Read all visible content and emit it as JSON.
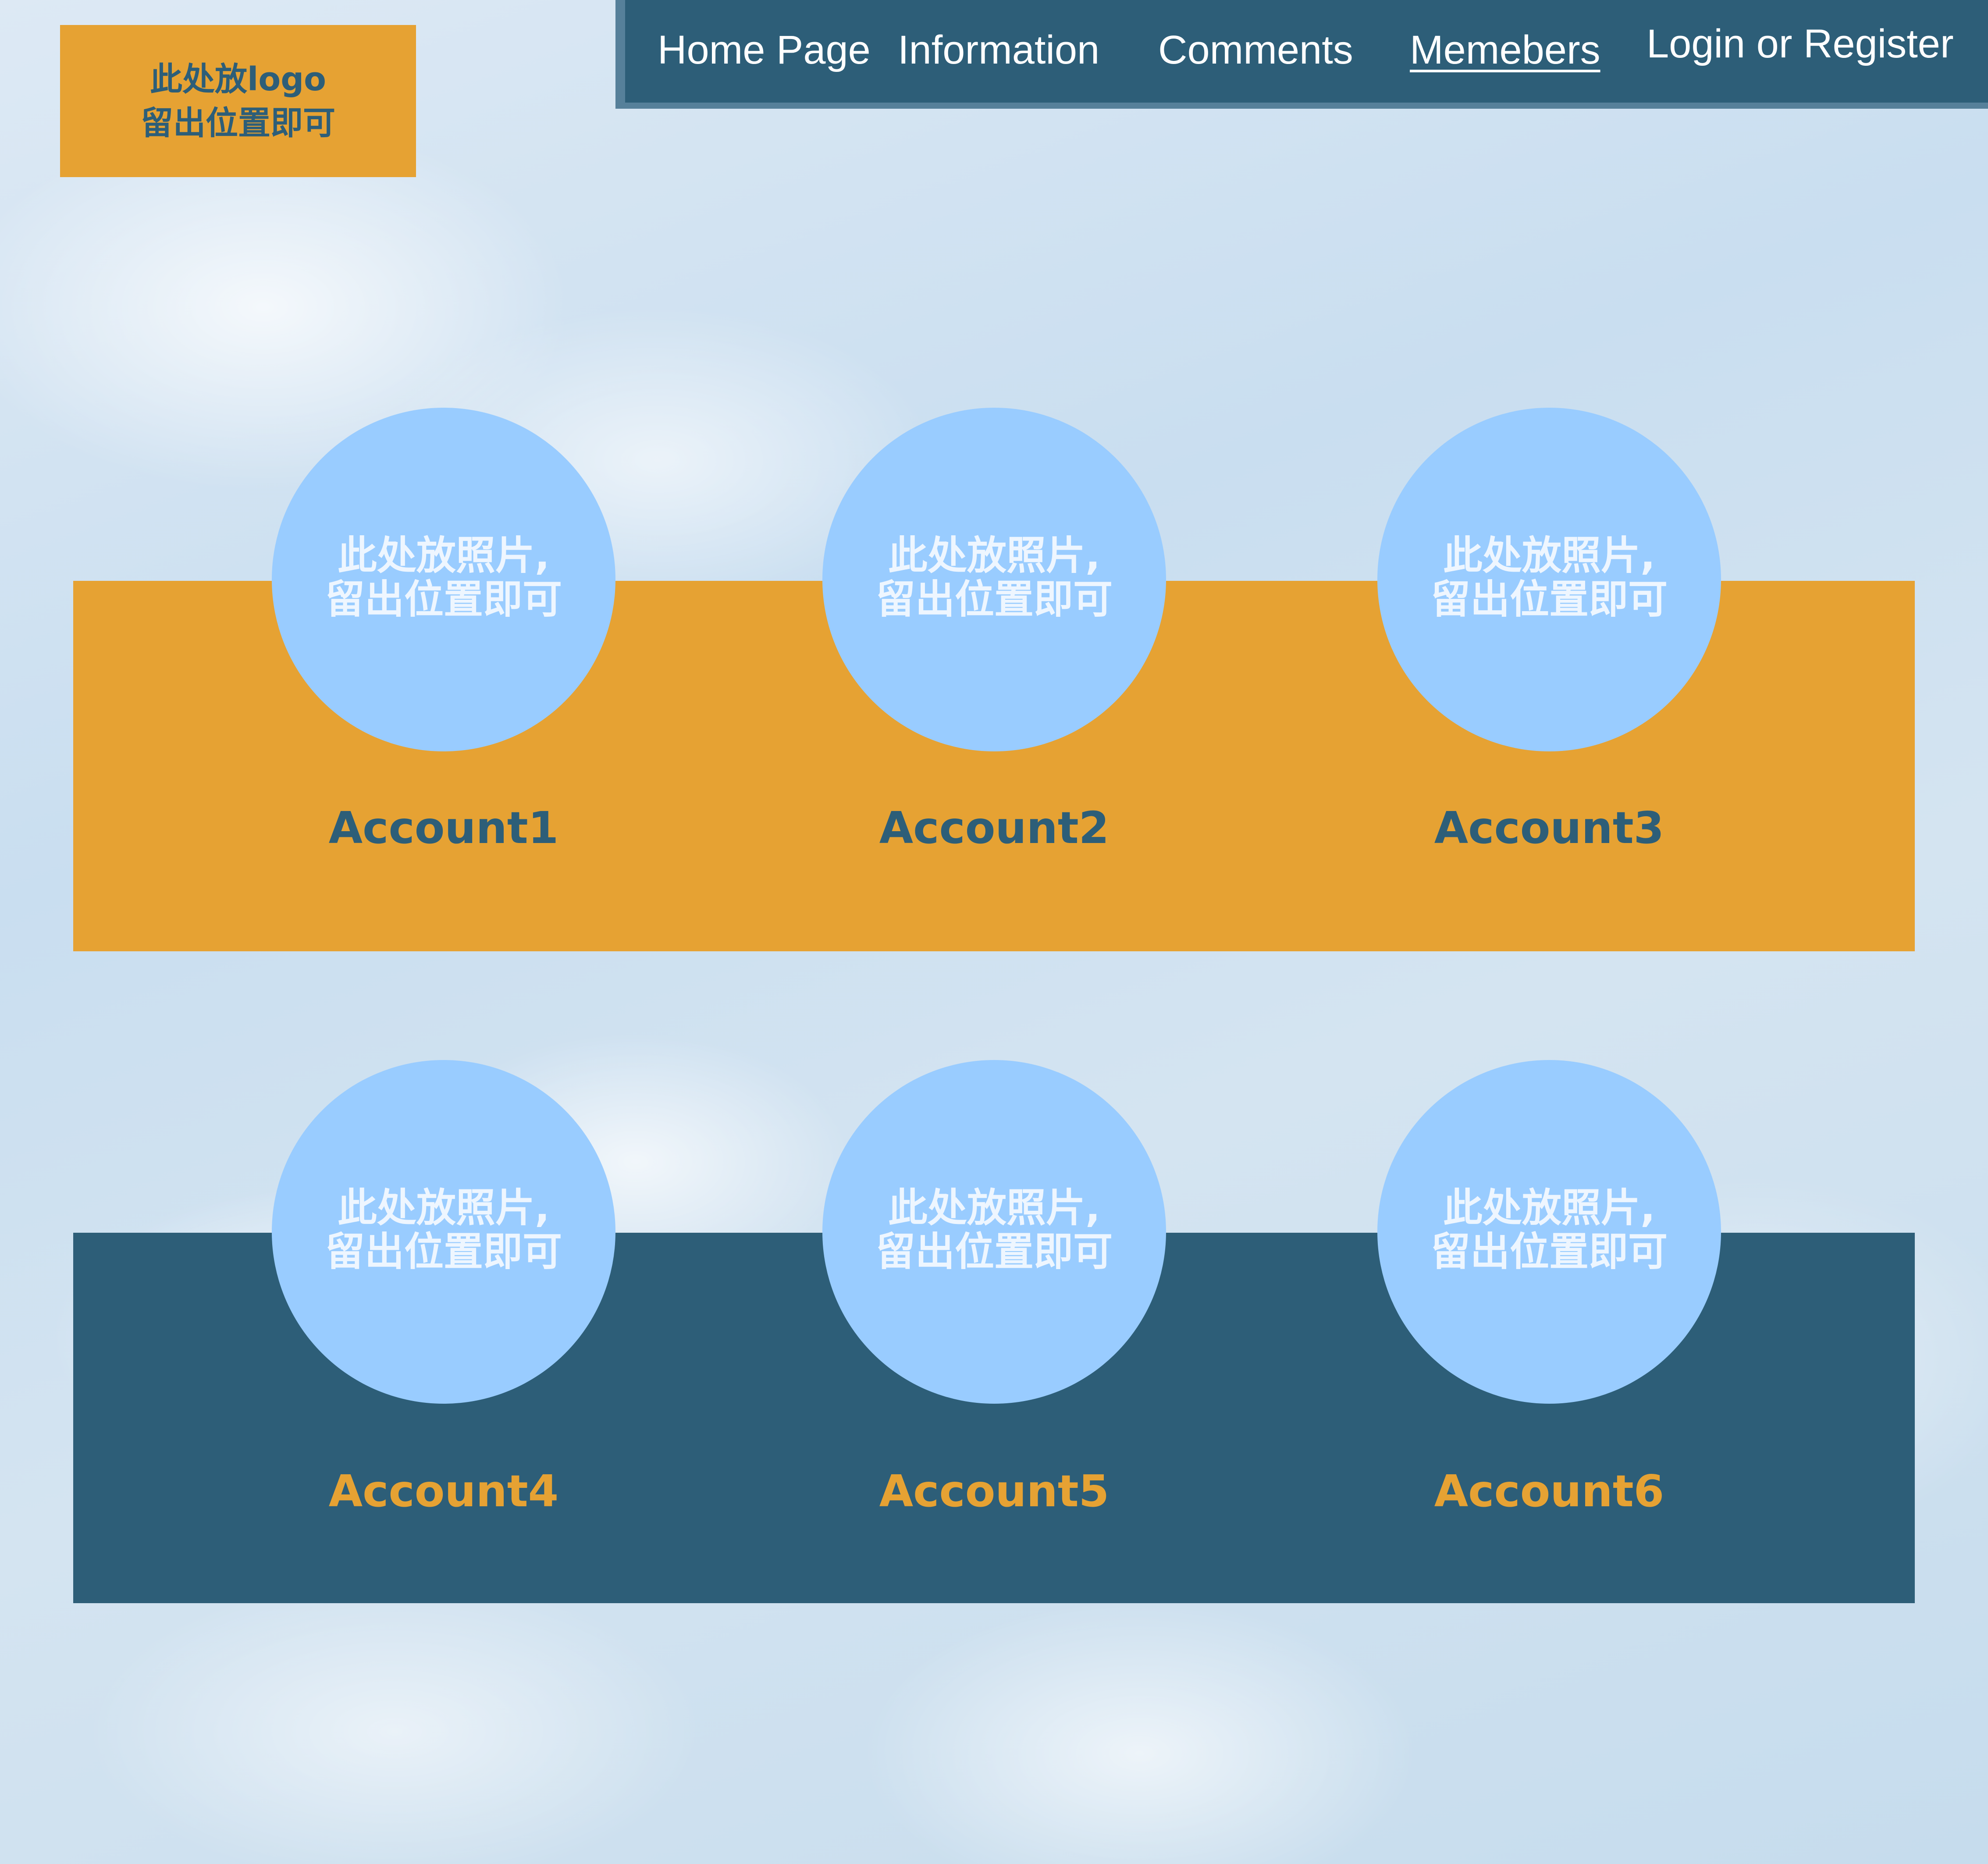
{
  "logo": {
    "line1": "此处放logo",
    "line2": "留出位置即可"
  },
  "nav": {
    "items": [
      {
        "label": "Home Page"
      },
      {
        "label": "Information"
      },
      {
        "label": "Comments"
      },
      {
        "label": "Memebers",
        "active": true
      },
      {
        "label": "Login or Register"
      }
    ]
  },
  "members": {
    "photo_line1": "此处放照片,",
    "photo_line2": "留出位置即可",
    "accounts": [
      {
        "name": "Account1"
      },
      {
        "name": "Account2"
      },
      {
        "name": "Account3"
      },
      {
        "name": "Account4"
      },
      {
        "name": "Account5"
      },
      {
        "name": "Account6"
      }
    ]
  },
  "colors": {
    "accent_orange": "#e6a233",
    "navy": "#2d5e78",
    "photo_placeholder": "#99ccff"
  }
}
